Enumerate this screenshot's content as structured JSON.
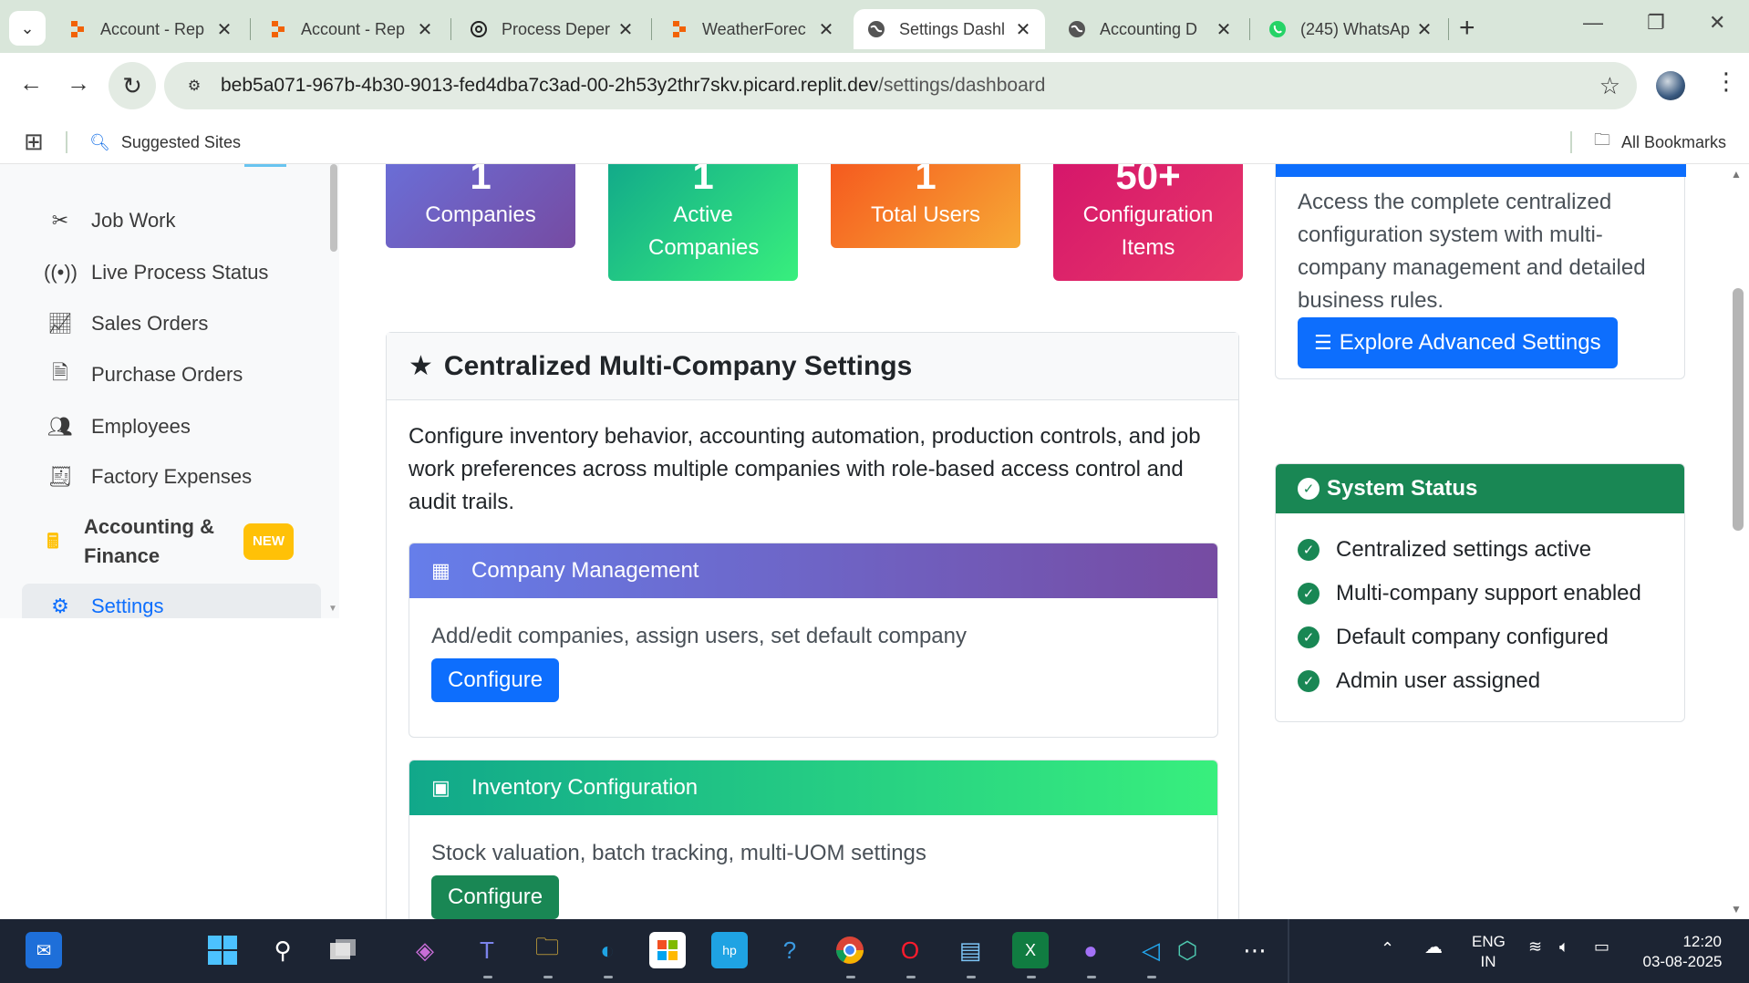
{
  "browser": {
    "tabs": [
      {
        "title": "Account - Rep",
        "icon": "replit-icon"
      },
      {
        "title": "Account - Rep",
        "icon": "replit-icon"
      },
      {
        "title": "Process Deper",
        "icon": "chatgpt-icon"
      },
      {
        "title": "WeatherForec",
        "icon": "replit-icon"
      },
      {
        "title": "Settings Dashl",
        "icon": "globe-icon",
        "active": true
      },
      {
        "title": "Accounting D",
        "icon": "globe-icon"
      },
      {
        "title": "(245) WhatsAp",
        "icon": "whatsapp-icon"
      }
    ],
    "url_host": "beb5a071-967b-4b30-9013-fed4dba7c3ad-00-2h53y2thr7skv.picard.replit.dev",
    "url_path": "/settings/dashboard",
    "bookmarks": {
      "suggested": "Suggested Sites",
      "all": "All Bookmarks"
    }
  },
  "sidebar": {
    "items": [
      {
        "label": "Job Work",
        "icon": "tools-icon"
      },
      {
        "label": "Live Process Status",
        "icon": "broadcast-icon"
      },
      {
        "label": "Sales Orders",
        "icon": "chart-line-icon"
      },
      {
        "label": "Purchase Orders",
        "icon": "file-invoice-icon"
      },
      {
        "label": "Employees",
        "icon": "users-icon"
      },
      {
        "label": "Factory Expenses",
        "icon": "receipt-icon"
      },
      {
        "label": "Accounting &\nFinance",
        "icon": "calculator-icon",
        "badge": "NEW"
      },
      {
        "label": "Settings",
        "icon": "cog-icon",
        "active": true
      }
    ]
  },
  "stats": [
    {
      "value": "1",
      "label": "Companies",
      "color": "#6f42c1"
    },
    {
      "value": "1",
      "label": "Active Companies",
      "color": "#20c997"
    },
    {
      "value": "1",
      "label": "Total Users",
      "color": "#fd7e14"
    },
    {
      "value": "50+",
      "label": "Configuration Items",
      "color": "#e0245e"
    }
  ],
  "main_panel": {
    "title": "Centralized Multi-Company Settings",
    "description": "Configure inventory behavior, accounting automation, production controls, and job work preferences across multiple companies with role-based access control and audit trails.",
    "cards": [
      {
        "title": "Company Management",
        "desc": "Add/edit companies, assign users, set default company",
        "button": "Configure",
        "icon": "building-icon"
      },
      {
        "title": "Inventory Configuration",
        "desc": "Stock valuation, batch tracking, multi-UOM settings",
        "button": "Configure",
        "icon": "boxes-icon"
      }
    ]
  },
  "advanced": {
    "text": "Access the complete centralized configuration system with multi-company management and detailed business rules.",
    "button": "Explore Advanced Settings"
  },
  "system_status": {
    "title": "System Status",
    "items": [
      "Centralized settings active",
      "Multi-company support enabled",
      "Default company configured",
      "Admin user assigned"
    ]
  },
  "taskbar": {
    "lang1": "ENG",
    "lang2": "IN",
    "time": "12:20",
    "date": "03-08-2025"
  }
}
